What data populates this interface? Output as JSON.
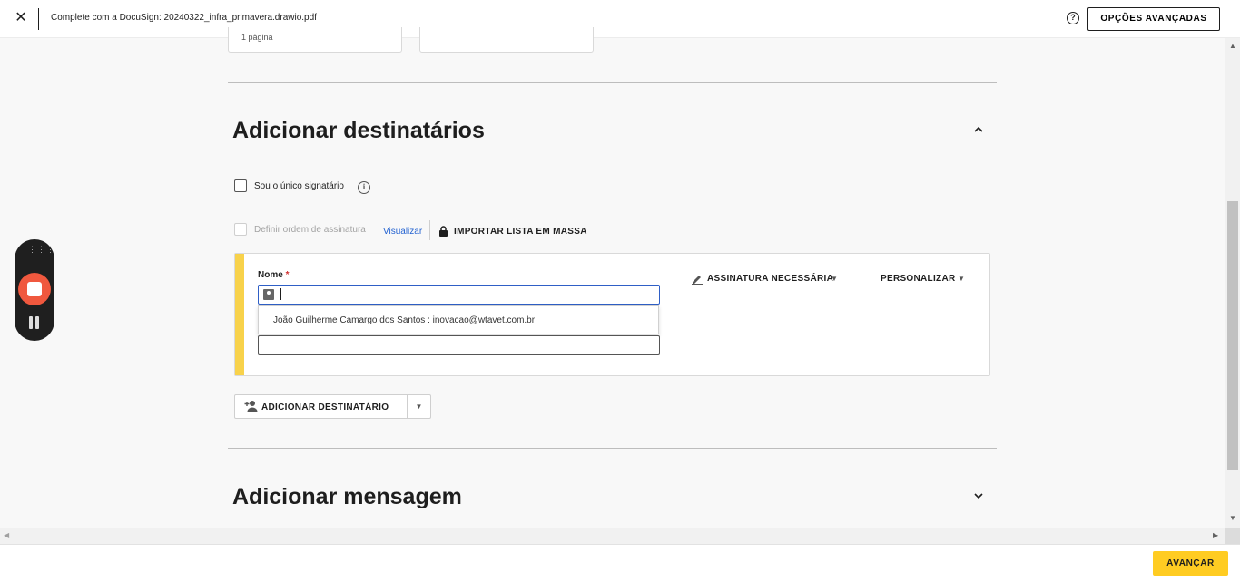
{
  "header": {
    "close_icon": "close-icon",
    "title": "Complete com a DocuSign: 20240322_infra_primavera.drawio.pdf",
    "help_icon": "help-circle-icon",
    "advanced_options": "OPÇÕES AVANÇADAS"
  },
  "top_cards": {
    "left_text": "1 página"
  },
  "recipients_section": {
    "title": "Adicionar destinatários",
    "only_signer": "Sou o único signatário",
    "signing_order": "Definir ordem de assinatura",
    "preview_link": "Visualizar",
    "bulk_import": "IMPORTAR LISTA EM MASSA",
    "recipient": {
      "name_label": "Nome",
      "required_marker": "*",
      "name_value": "",
      "suggestion": "João Guilherme Camargo dos Santos : inovacao@wtavet.com.br",
      "email_value": "",
      "signature_action": "ASSINATURA NECESSÁRIA",
      "customize": "PERSONALIZAR"
    },
    "add_recipient": "ADICIONAR DESTINATÁRIO"
  },
  "message_section": {
    "title": "Adicionar mensagem"
  },
  "footer": {
    "next": "AVANÇAR"
  },
  "colors": {
    "accent_yellow": "#ffcc22",
    "stripe_yellow": "#f8d24b",
    "link_blue": "#2463d1",
    "recorder_stop": "#f0583e"
  }
}
